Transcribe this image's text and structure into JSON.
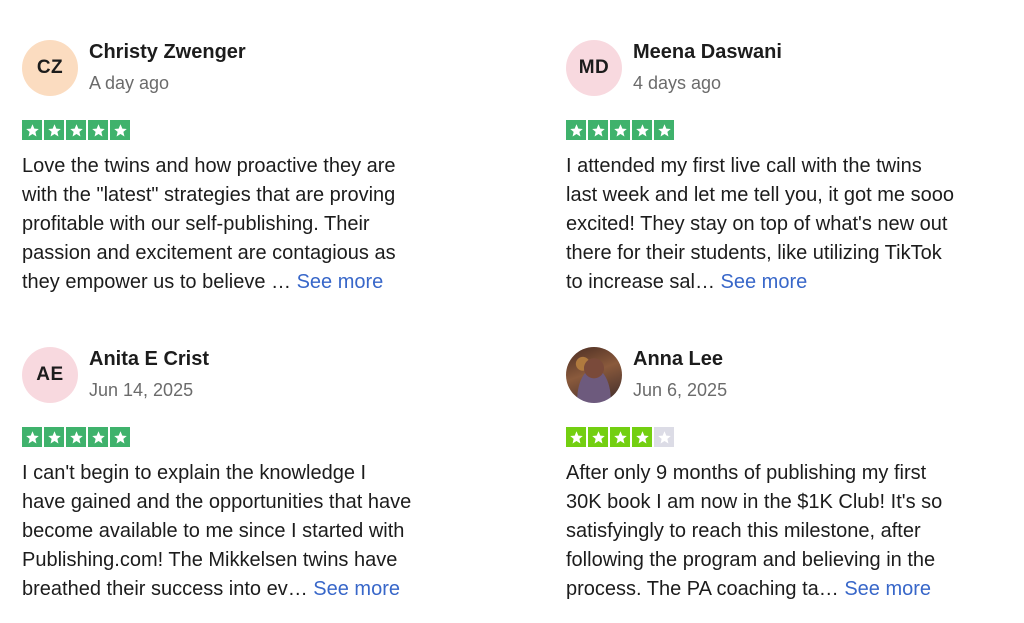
{
  "reviews": [
    {
      "initials": "CZ",
      "name": "Christy Zwenger",
      "date": "A day ago",
      "rating": 5,
      "lines": [
        "Love the twins and how proactive they are",
        "with the \"latest\" strategies that are proving",
        "profitable with our self-publishing. Their",
        "passion and excitement are contagious as",
        "they empower us to believe … "
      ],
      "see_more": "See more"
    },
    {
      "initials": "MD",
      "name": "Meena Daswani",
      "date": "4 days ago",
      "rating": 5,
      "lines": [
        "I attended my first live call with the twins",
        "last week and let me tell you, it got me sooo",
        "excited! They stay on top of what's new out",
        "there for their students, like utilizing TikTok",
        "to increase sal… "
      ],
      "see_more": "See more"
    },
    {
      "initials": "AE",
      "name": "Anita E Crist",
      "date": "Jun 14, 2025",
      "rating": 5,
      "lines": [
        "I can't begin to explain the knowledge I",
        "have gained and the opportunities that have",
        "become available to me since I started with",
        "Publishing.com! The Mikkelsen twins have",
        "breathed their success into ev… "
      ],
      "see_more": "See more"
    },
    {
      "initials": "",
      "name": "Anna Lee",
      "date": "Jun 6, 2025",
      "rating": 4,
      "lines": [
        "After only 9 months of publishing my first",
        "30K book I am now in the $1K Club! It's so",
        "satisfyingly to reach this milestone, after",
        "following the program and believing in the",
        "process. The PA coaching ta… "
      ],
      "see_more": "See more"
    }
  ],
  "colors": {
    "star_five": "#3fb26c",
    "star_four": "#73cf11",
    "star_empty": "#dcdce6",
    "link": "#3867c9"
  }
}
